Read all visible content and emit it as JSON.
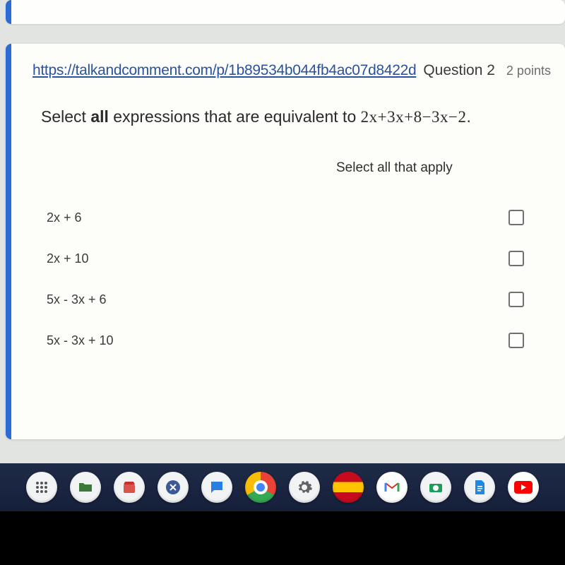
{
  "header": {
    "link_text": "https://talkandcomment.com/p/1b89534b044fb4ac07d8422d",
    "question_label": "Question 2",
    "points_label": "2 points"
  },
  "prompt": {
    "prefix": "Select ",
    "bold_word": "all",
    "middle": " expressions that are equivalent to  ",
    "expression": "2x+3x+8−3x−2",
    "suffix": "."
  },
  "select_hint": "Select all that apply",
  "options": [
    {
      "label": "2x + 6"
    },
    {
      "label": "2x + 10"
    },
    {
      "label": "5x - 3x + 6"
    },
    {
      "label": "5x - 3x + 10"
    }
  ],
  "taskbar": {
    "icons": [
      "launcher-icon",
      "files-icon",
      "store-icon",
      "close-app-icon",
      "messages-icon",
      "chrome-icon",
      "settings-icon",
      "spain-flag-icon",
      "gmail-icon",
      "camera-icon",
      "docs-icon",
      "youtube-icon"
    ]
  }
}
